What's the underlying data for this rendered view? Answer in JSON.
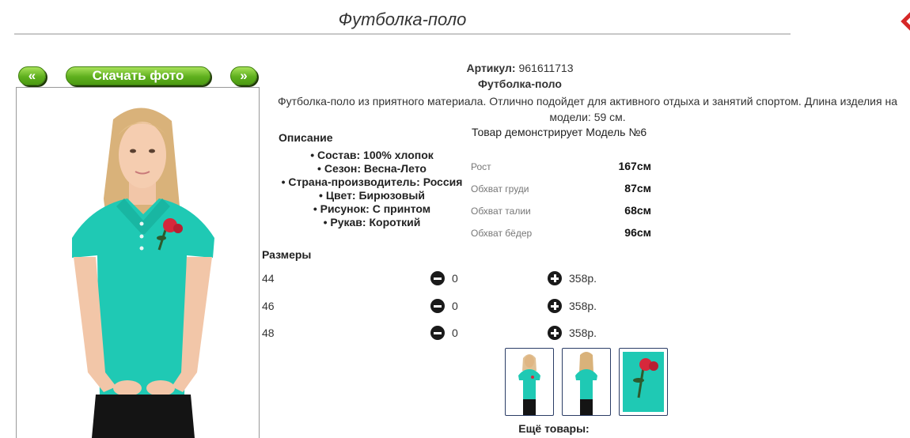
{
  "page": {
    "title": "Футболка-поло"
  },
  "gallery": {
    "prev_label": "«",
    "download_label": "Скачать фото",
    "next_label": "»"
  },
  "product": {
    "article_label": "Артикул:",
    "article_value": "961611713",
    "name": "Футболка-поло",
    "description": "Футболка-поло из приятного материала. Отлично подойдет для активного отдыха и занятий спортом. Длина изделия на модели: 59 см."
  },
  "details": {
    "heading": "Описание",
    "attributes": [
      "Состав: 100% хлопок",
      "Сезон: Весна-Лето",
      "Страна-производитель: Россия",
      "Цвет: Бирюзовый",
      "Рисунок: С принтом",
      "Рукав: Короткий"
    ]
  },
  "model": {
    "caption": "Товар демонстрирует Модель №6",
    "metrics": [
      {
        "label": "Рост",
        "value": "167см"
      },
      {
        "label": "Обхват груди",
        "value": "87см"
      },
      {
        "label": "Обхват талии",
        "value": "68см"
      },
      {
        "label": "Обхват бёдер",
        "value": "96см"
      }
    ]
  },
  "sizes": {
    "heading": "Размеры",
    "rows": [
      {
        "size": "44",
        "qty": "0",
        "price": "358р."
      },
      {
        "size": "46",
        "qty": "0",
        "price": "358р."
      },
      {
        "size": "48",
        "qty": "0",
        "price": "358р."
      }
    ]
  },
  "thumbnails": [
    "front-view",
    "back-view",
    "print-closeup"
  ],
  "more": {
    "label": "Ещё товары:"
  },
  "colors": {
    "shirt": "#1fc9b4",
    "button_green": "#5fb01e",
    "thumb_border": "#2b3d66"
  }
}
